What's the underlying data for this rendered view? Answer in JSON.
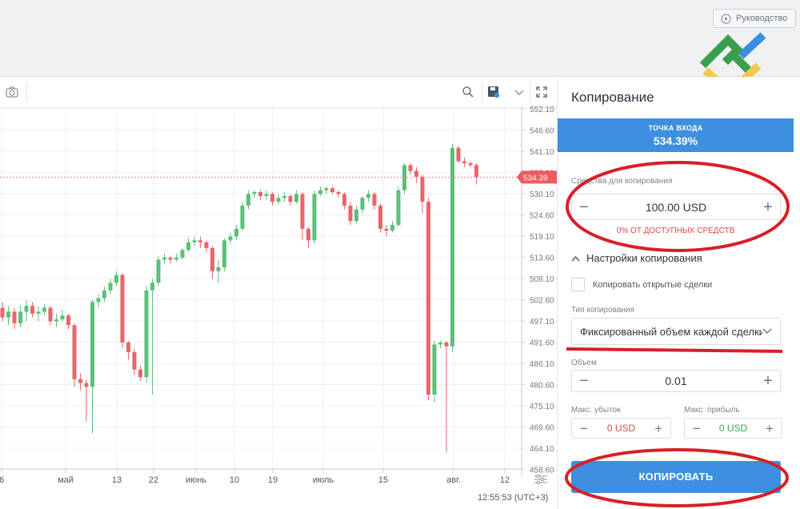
{
  "header": {
    "guide_label": "Руководство",
    "logo_icon": "brand-logo-icon"
  },
  "chart": {
    "last_price": "534.39",
    "time_label": "12:55:53 (UTC+3)",
    "y_ticks": [
      "552.10",
      "546.60",
      "541.10",
      "535.60",
      "530.10",
      "524.60",
      "519.10",
      "513.60",
      "508.10",
      "502.60",
      "497.10",
      "491.60",
      "486.10",
      "480.60",
      "475.10",
      "469.60",
      "464.10",
      "458.60"
    ],
    "x_ticks": [
      "6",
      "май",
      "13",
      "22",
      "июнь",
      "10",
      "19",
      "июль",
      "15",
      "авг.",
      "12"
    ],
    "colors": {
      "up": "#5cbf7a",
      "down": "#e8666b",
      "price_tag": "#ef5a5e"
    },
    "icons": [
      "camera-icon",
      "search-icon",
      "save-icon",
      "chevron-down-icon",
      "expand-icon",
      "settings-sliders-icon"
    ]
  },
  "panel": {
    "title": "Копирование",
    "entry_label": "ТОЧКА ВХОДА",
    "entry_value": "534.39%",
    "funds_label": "Средства для копирования",
    "funds_value": "100.00 USD",
    "available": "0% ОТ ДОСТУПНЫХ СРЕДСТВ",
    "settings_label": "Настройки копирования",
    "copy_open_label": "Копировать открытые сделки",
    "copy_type_label": "Тип копирования",
    "copy_type_value": "Фиксированный объем каждой сделки",
    "volume_label": "Объем",
    "volume_value": "0.01",
    "max_loss_label": "Макс. убыток",
    "max_loss_value": "0 USD",
    "max_profit_label": "Макс. прибыль",
    "max_profit_value": "0 USD",
    "copy_button": "КОПИРОВАТЬ",
    "accent": "#3d8fe0"
  }
}
